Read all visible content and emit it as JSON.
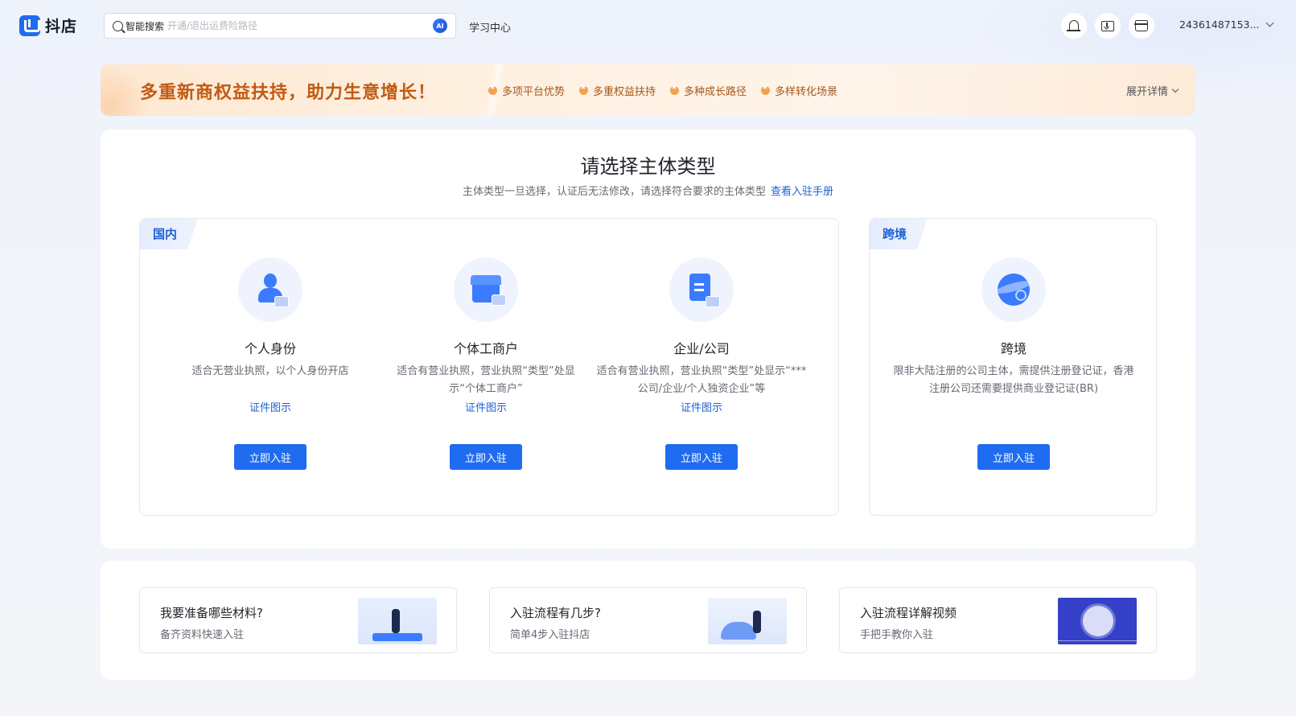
{
  "header": {
    "logo_text": "抖店",
    "search_label": "智能搜索",
    "search_placeholder": "开通/退出运费险路径",
    "ai_badge": "AI",
    "learn_center": "学习中心",
    "username": "24361487153..."
  },
  "banner": {
    "title": "多重新商权益扶持，助力生意增长！",
    "tags": [
      "多项平台优势",
      "多重权益扶持",
      "多种成长路径",
      "多样转化场景"
    ],
    "expand_label": "展开详情"
  },
  "main": {
    "title": "请选择主体类型",
    "subtitle": "主体类型一旦选择，认证后无法修改，请选择符合要求的主体类型",
    "manual_link": "查看入驻手册",
    "domestic": {
      "tag": "国内",
      "options": [
        {
          "title": "个人身份",
          "desc": "适合无营业执照，以个人身份开店",
          "link": "证件图示",
          "button": "立即入驻"
        },
        {
          "title": "个体工商户",
          "desc": "适合有营业执照，营业执照“类型”处显示“个体工商户”",
          "link": "证件图示",
          "button": "立即入驻"
        },
        {
          "title": "企业/公司",
          "desc": "适合有营业执照，营业执照“类型”处显示“***公司/企业/个人独资企业”等",
          "link": "证件图示",
          "button": "立即入驻"
        }
      ]
    },
    "cross_border": {
      "tag": "跨境",
      "option": {
        "title": "跨境",
        "desc": "限非大陆注册的公司主体，需提供注册登记证，香港注册公司还需要提供商业登记证(BR)",
        "button": "立即入驻"
      }
    }
  },
  "help": [
    {
      "title": "我要准备哪些材料?",
      "sub": "备齐资料快速入驻"
    },
    {
      "title": "入驻流程有几步?",
      "sub": "简单4步入驻抖店"
    },
    {
      "title": "入驻流程详解视频",
      "sub": "手把手教你入驻"
    }
  ],
  "colors": {
    "brand": "#1f6cf0",
    "banner_text": "#c25a12",
    "link": "#1f5fd6"
  }
}
